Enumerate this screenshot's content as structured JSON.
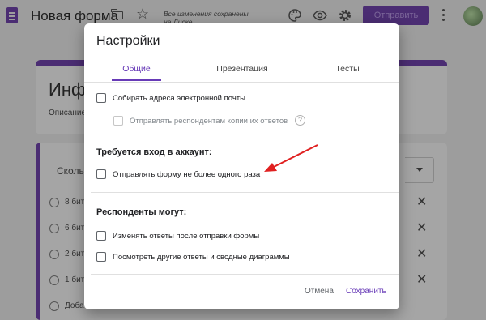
{
  "header": {
    "title": "Новая форма",
    "saved_status": "Все изменения сохранены на Диске",
    "send_label": "Отправить",
    "icons": [
      "form-icon",
      "folder-icon",
      "star-icon",
      "palette-icon",
      "eye-icon",
      "gear-icon",
      "more-vert-icon"
    ]
  },
  "background": {
    "form_heading": "Инф",
    "form_description": "Описание",
    "question_text": "Сколь",
    "options": [
      "8 бит",
      "6 бит",
      "2 бит",
      "1 бит",
      "Доба"
    ]
  },
  "dialog": {
    "title": "Настройки",
    "tabs": [
      {
        "label": "Общие",
        "active": true
      },
      {
        "label": "Презентация",
        "active": false
      },
      {
        "label": "Тесты",
        "active": false
      }
    ],
    "collect_emails": {
      "label": "Собирать адреса электронной почты",
      "checked": false
    },
    "send_copies": {
      "label": "Отправлять респондентам копии их ответов",
      "checked": false,
      "disabled": true
    },
    "login_section": {
      "title": "Требуется вход в аккаунт:",
      "limit_one_response": {
        "label": "Отправлять форму не более одного раза",
        "checked": false
      }
    },
    "respondents_section": {
      "title": "Респонденты могут:",
      "edit_after_submit": {
        "label": "Изменять ответы после отправки формы",
        "checked": false
      },
      "see_summary": {
        "label": "Посмотреть другие ответы и сводные диаграммы",
        "checked": false
      }
    },
    "cancel_label": "Отмена",
    "save_label": "Сохранить"
  },
  "colors": {
    "accent": "#673ab7",
    "header_purple": "#4b2d73",
    "annotation_arrow": "#e02020"
  }
}
